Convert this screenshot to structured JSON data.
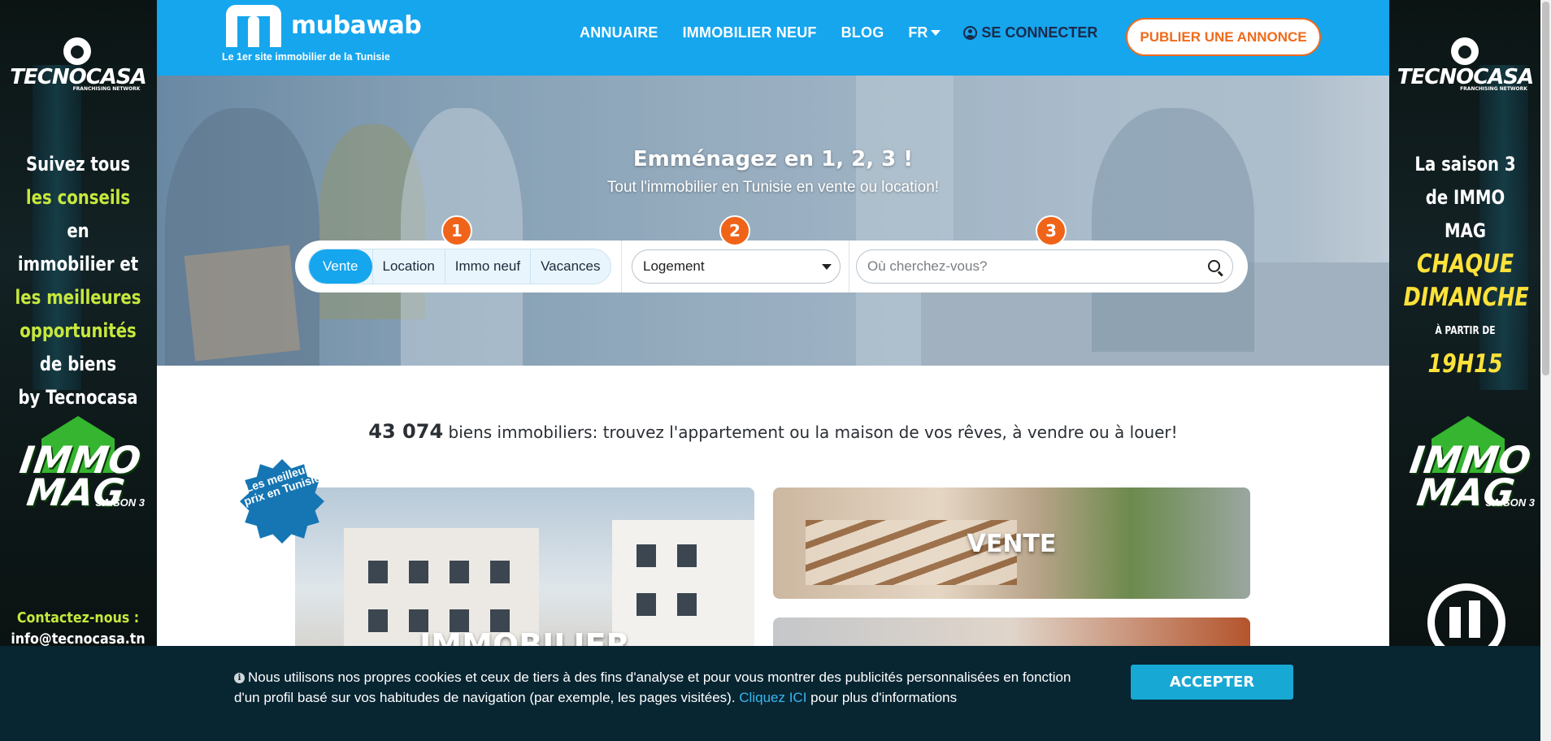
{
  "header": {
    "logo_text": "mubawab",
    "tagline": "Le 1er site immobilier de la Tunisie",
    "nav": [
      "ANNUAIRE",
      "IMMOBILIER NEUF",
      "BLOG"
    ],
    "lang": "FR",
    "login": "SE CONNECTER",
    "publish": "PUBLIER UNE ANNONCE"
  },
  "hero": {
    "title": "Emménagez en 1, 2, 3 !",
    "subtitle": "Tout l'immobilier en Tunisie en vente ou location!",
    "steps": [
      "1",
      "2",
      "3"
    ],
    "tabs": [
      "Vente",
      "Location",
      "Immo neuf",
      "Vacances"
    ],
    "active_tab": "Vente",
    "type_select": "Logement",
    "search_placeholder": "Où cherchez-vous?"
  },
  "listing": {
    "count": "43 074",
    "count_text": "biens immobiliers: trouvez l'appartement ou la maison de vos rêves, à vendre ou à louer!",
    "badge": "Les meilleurs prix en Tunisie!",
    "cards": {
      "immobilier": "IMMOBILIER",
      "vente": "VENTE"
    }
  },
  "ads": {
    "left": {
      "brand": "TECNOCASA",
      "brand_sub": "FRANCHISING NETWORK",
      "msg": [
        "Suivez tous",
        "les conseils",
        "en",
        "immobilier et",
        "les meilleures",
        "opportunités",
        "de biens",
        "by Tecnocasa"
      ],
      "immomag": [
        "IMMO",
        "MAG",
        "SAISON 3"
      ],
      "contact": [
        "Contactez-nous :",
        "info@tecnocasa.tn"
      ]
    },
    "right": {
      "brand": "TECNOCASA",
      "brand_sub": "FRANCHISING NETWORK",
      "msg": [
        "La saison 3",
        "de IMMO MAG",
        "CHAQUE",
        "DIMANCHE",
        "À PARTIR DE",
        "19H15"
      ],
      "immomag": [
        "IMMO",
        "MAG",
        "SAISON 3"
      ]
    }
  },
  "cookie": {
    "text": "Nous utilisons nos propres cookies et ceux de tiers à des fins d'analyse et pour vous montrer des publicités personnalisées en fonction d'un profil basé sur vos habitudes de navigation (par exemple, les pages visitées).",
    "link": "Cliquez ICI",
    "text_after": "pour plus d'informations",
    "accept": "ACCEPTER"
  },
  "colors": {
    "brand_blue": "#15a6ee",
    "accent_orange": "#ef6b1d",
    "cookie_bg": "#082532",
    "accept_button": "#18a8d4"
  }
}
